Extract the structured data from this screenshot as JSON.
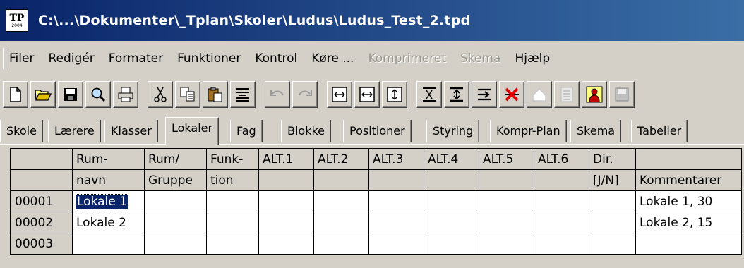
{
  "window": {
    "title": "C:\\...\\Dokumenter\\_Tplan\\Skoler\\Ludus\\Ludus_Test_2.tpd",
    "icon_text": "TP",
    "icon_sub": "2004"
  },
  "menu": [
    {
      "label": "Filer",
      "enabled": true
    },
    {
      "label": "Redigér",
      "enabled": true
    },
    {
      "label": "Formater",
      "enabled": true
    },
    {
      "label": "Funktioner",
      "enabled": true
    },
    {
      "label": "Kontrol",
      "enabled": true
    },
    {
      "label": "Køre ...",
      "enabled": true
    },
    {
      "label": "Komprimeret",
      "enabled": false
    },
    {
      "label": "Skema",
      "enabled": false
    },
    {
      "label": "Hjælp",
      "enabled": true
    }
  ],
  "toolbar": [
    "new-icon",
    "open-icon",
    "save-icon",
    "search-icon",
    "print-icon",
    "cut-icon",
    "copy-icon",
    "paste-icon",
    "align-icon",
    "undo-icon",
    "redo-icon",
    "column-width-icon",
    "column-width-2-icon",
    "row-height-icon",
    "sort-icon",
    "compress-icon",
    "insert-icon",
    "delete-icon",
    "up-icon",
    "lines-icon",
    "teacher-icon",
    "disk-icon"
  ],
  "tabs": [
    "Skole",
    "Lærere",
    "Klasser",
    "Lokaler",
    "Fag",
    "Blokke",
    "Positioner",
    "Styring",
    "Kompr-Plan",
    "Skema",
    "Tabeller"
  ],
  "active_tab": "Lokaler",
  "grid": {
    "header1": [
      "Rum-",
      "Rum/",
      "Funk-",
      "ALT.1",
      "ALT.2",
      "ALT.3",
      "ALT.4",
      "ALT.5",
      "ALT.6",
      "Dir.",
      ""
    ],
    "header2": [
      "navn",
      "Gruppe",
      "tion",
      "",
      "",
      "",
      "",
      "",
      "",
      "[J/N]",
      "Kommentarer"
    ],
    "rows": [
      {
        "id": "00001",
        "cells": [
          "Lokale 1",
          "",
          "",
          "",
          "",
          "",
          "",
          "",
          "",
          "",
          "Lokale 1, 30"
        ]
      },
      {
        "id": "00002",
        "cells": [
          "Lokale 2",
          "",
          "",
          "",
          "",
          "",
          "",
          "",
          "",
          "",
          "Lokale 2, 15"
        ]
      },
      {
        "id": "00003",
        "cells": [
          "",
          "",
          "",
          "",
          "",
          "",
          "",
          "",
          "",
          "",
          ""
        ]
      }
    ]
  }
}
